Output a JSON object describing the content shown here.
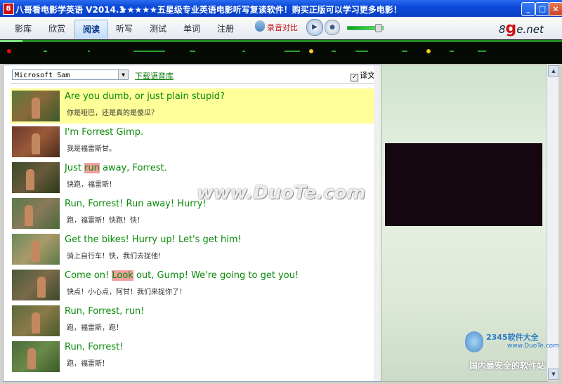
{
  "window": {
    "title": "八哥看电影学英语 V2014.1",
    "slogan": "★★★★★五星级专业英语电影听写复读软件！购买正版可以学习更多电影！",
    "min_label": "_",
    "max_label": "□",
    "close_label": "×"
  },
  "menu": {
    "tabs": [
      "影库",
      "欣赏",
      "阅读",
      "听写",
      "测试",
      "单词",
      "注册"
    ],
    "active_tab": "阅读",
    "record_label": "录音对比",
    "play_label": "▶",
    "stop_label": "●",
    "volume": 0.85,
    "logo_prefix": "8",
    "logo_g": "g",
    "logo_suffix": "e.net"
  },
  "timeline": {
    "progress": 0.04
  },
  "reading": {
    "voice_select": "Microsoft Sam",
    "download_link": "下载语音库",
    "translate_label": "译文",
    "translate_checked": true,
    "checkbox_glyph": "✓",
    "lines": [
      {
        "en": "Are you dumb, or just plain stupid?",
        "cn": "你是哑巴，还是真的是傻瓜？",
        "highlight": true
      },
      {
        "en": "I'm Forrest Gimp.",
        "cn": "我是福雷斯甘。"
      },
      {
        "en_pre": "Just ",
        "en_mark": "run",
        "en_post": " away, Forrest.",
        "cn": "快跑，福雷斯！"
      },
      {
        "en": "Run, Forrest! Run away! Hurry!",
        "cn": "跑，福雷斯！快跑！快！"
      },
      {
        "en": "Get the bikes! Hurry up! Let's get him!",
        "cn": "骑上自行车！快，我们去捉他！"
      },
      {
        "en_pre": "Come on! ",
        "en_mark": "Look",
        "en_post": " out, Gump! We're going to get you!",
        "cn": "快点！小心点，阿甘！我们来捉你了！"
      },
      {
        "en": "Run, Forrest, run!",
        "cn": "跑，福雷斯，跑！"
      },
      {
        "en": "Run, Forrest!",
        "cn": "跑，福雷斯！"
      }
    ]
  },
  "watermarks": {
    "duote": "www.DuoTe.com",
    "site_name": "2345软件大全",
    "site_url": "www.DuoTe.com",
    "site_slogan": "国内最安全的软件站"
  }
}
